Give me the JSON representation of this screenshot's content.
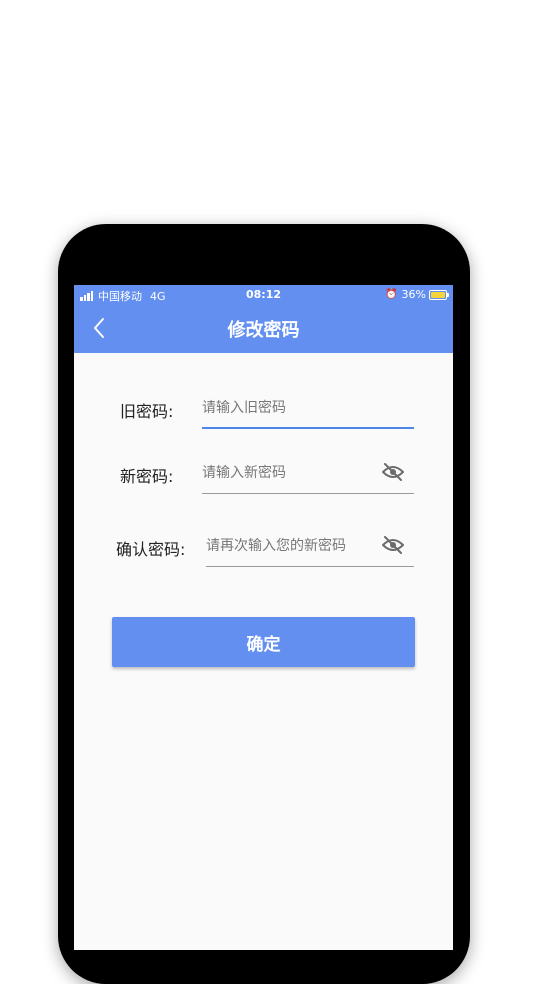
{
  "status_bar": {
    "carrier": "中国移动",
    "network": "4G",
    "time": "08:12",
    "battery": "36%",
    "icons": [
      "signal-icon",
      "alarm-icon",
      "battery-charging-icon"
    ]
  },
  "nav": {
    "title": "修改密码",
    "back_icon": "chevron-left-icon"
  },
  "form": {
    "old_password": {
      "label": "旧密码:",
      "placeholder": "请输入旧密码",
      "value": ""
    },
    "new_password": {
      "label": "新密码:",
      "placeholder": "请输入新密码",
      "value": "",
      "toggle_icon": "eye-off-icon"
    },
    "confirm_password": {
      "label": "确认密码:",
      "placeholder": "请再次输入您的新密码",
      "value": "",
      "toggle_icon": "eye-off-icon"
    },
    "submit_label": "确定"
  },
  "colors": {
    "accent": "#628ff0",
    "focus_underline": "#4d86e8",
    "underline": "#9a9a9a",
    "background": "#fafafa"
  }
}
